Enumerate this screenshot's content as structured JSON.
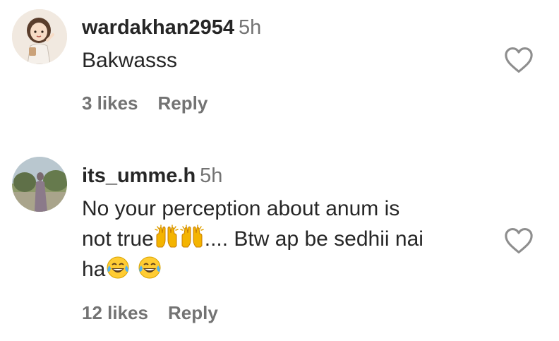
{
  "comments": [
    {
      "username": "wardakhan2954",
      "time": "5h",
      "text": "Bakwasss",
      "likes": "3 likes",
      "reply": "Reply",
      "avatar_icon": "cartoon-girl-avatar"
    },
    {
      "username": "its_umme.h",
      "time": "5h",
      "text_line1": "No your perception about anum is",
      "text_line2_a": "not true",
      "text_line2_b": ".... Btw ap be sedhii nai",
      "text_line3": "ha",
      "likes": "12 likes",
      "reply": "Reply",
      "avatar_icon": "outdoor-photo-avatar"
    }
  ],
  "icons": {
    "heart": "heart-outline-icon",
    "raising_hands": "raising-hands-emoji",
    "laughing": "tears-of-joy-emoji"
  },
  "colors": {
    "text": "#262626",
    "muted": "#737373",
    "heart": "#8e8e8e"
  }
}
